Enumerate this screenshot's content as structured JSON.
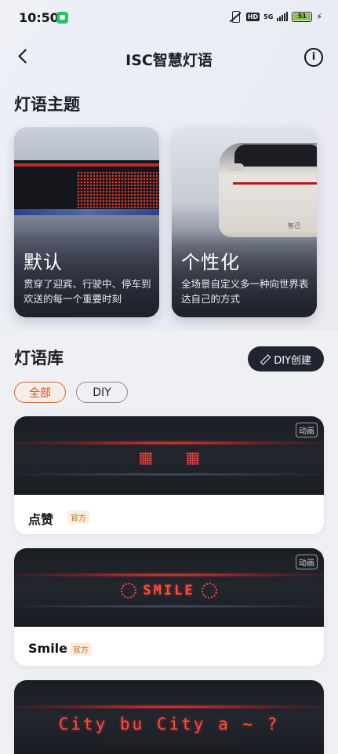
{
  "status_bar": {
    "time": "10:50",
    "hd": "HD",
    "network": "5G",
    "battery": "51"
  },
  "header": {
    "title": "ISC智慧灯语",
    "info_label": "i"
  },
  "themes_section": {
    "title": "灯语主题",
    "cards": [
      {
        "name": "默认",
        "desc": "贯穿了迎宾、行驶中、停车到欢送的每一个重要时刻"
      },
      {
        "name": "个性化",
        "desc": "全场景自定义多一种向世界表达自己的方式",
        "car_badge": "智己"
      }
    ]
  },
  "library_section": {
    "title": "灯语库",
    "diy_button": "DIY创建",
    "filters": [
      "全部",
      "DIY"
    ],
    "active_filter": "全部",
    "items": [
      {
        "name": "点赞",
        "badge": "官方",
        "tag": "动画",
        "display_text": ""
      },
      {
        "name": "Smile",
        "badge": "官方",
        "tag": "动画",
        "display_text": "SMILE"
      },
      {
        "name": "",
        "badge": "",
        "tag": "",
        "display_text": "City bu City a ~ ?"
      }
    ]
  },
  "colors": {
    "accent": "#d0541e",
    "dark_button": "#1f2430",
    "light_red": "#ff4a3d"
  }
}
